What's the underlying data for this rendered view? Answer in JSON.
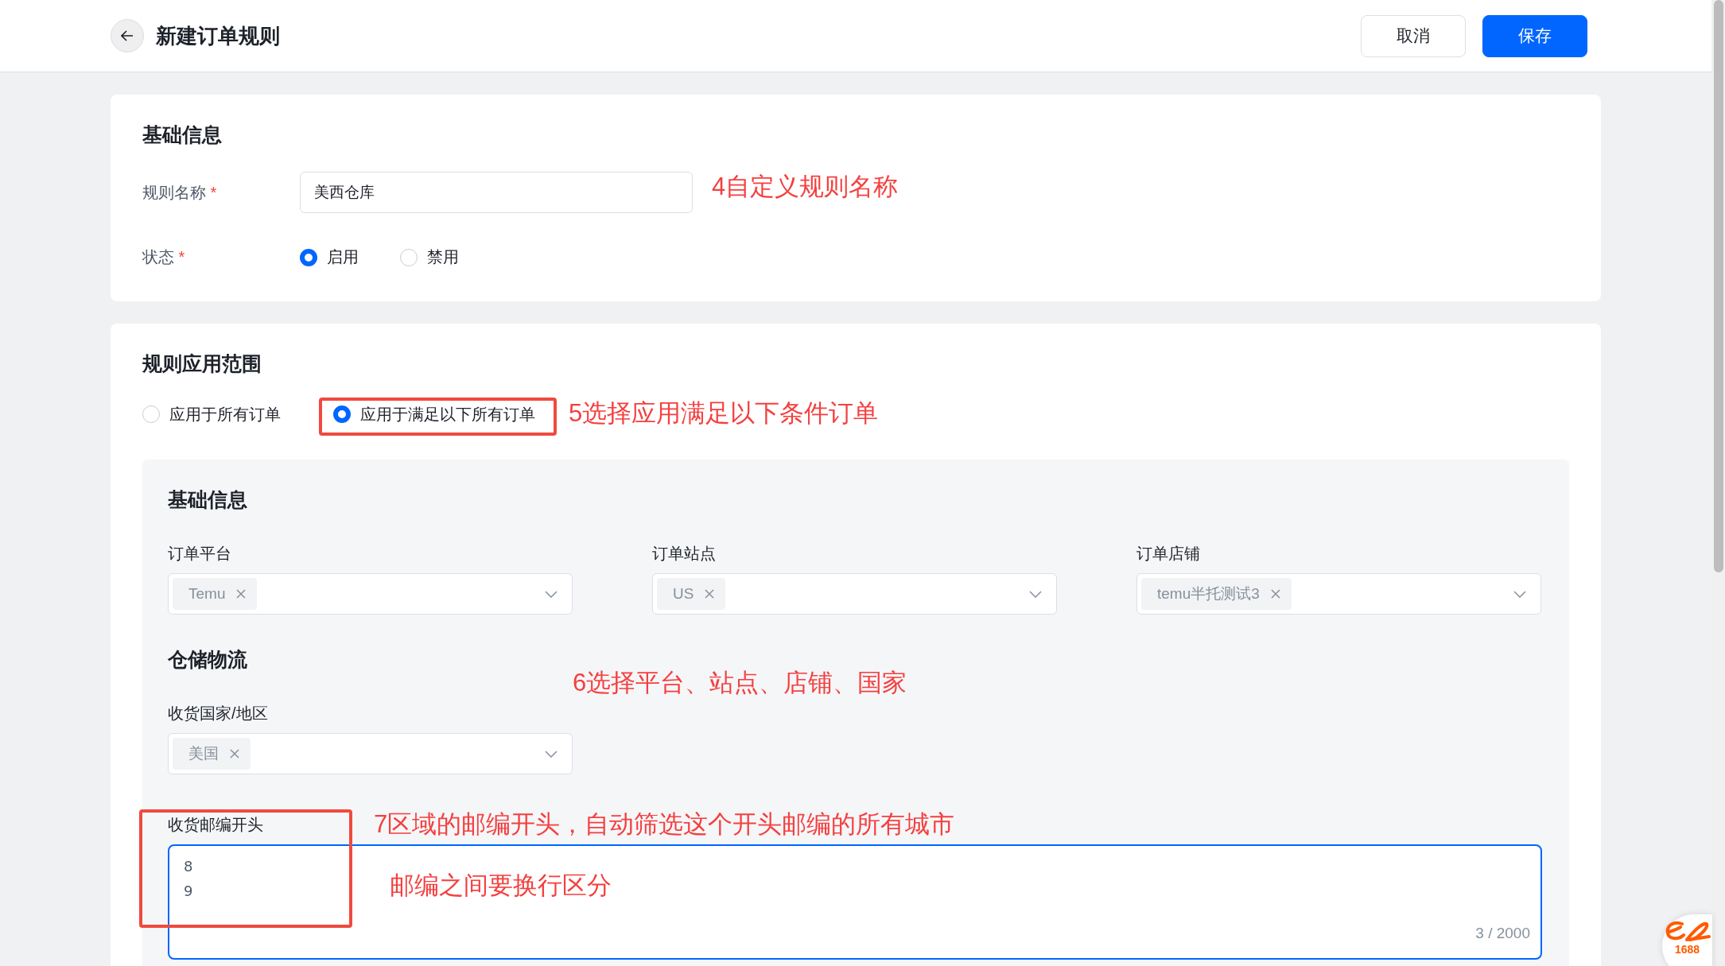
{
  "header": {
    "title": "新建订单规则",
    "buttons": [
      {
        "label": "取消",
        "kind": "default"
      },
      {
        "label": "保存",
        "kind": "primary"
      }
    ]
  },
  "basic": {
    "title": "基础信息",
    "name_field": {
      "label": "规则名称",
      "required_mark": "*",
      "value": "美西仓库"
    },
    "status": {
      "label": "状态",
      "required_mark": "*",
      "options": [
        {
          "label": "启用",
          "selected": true
        },
        {
          "label": "禁用",
          "selected": false
        }
      ]
    }
  },
  "scope": {
    "title": "规则应用范围",
    "options": [
      {
        "label": "应用于所有订单",
        "selected": false
      },
      {
        "label": "应用于满足以下所有订单",
        "selected": true
      }
    ],
    "panel": {
      "sections": [
        {
          "title": "基础信息",
          "fields": [
            {
              "label": "订单平台",
              "tags": [
                "Temu"
              ]
            },
            {
              "label": "订单站点",
              "tags": [
                "US"
              ]
            },
            {
              "label": "订单店铺",
              "tags": [
                "temu半托测试3"
              ]
            }
          ]
        },
        {
          "title": "仓储物流",
          "fields": [
            {
              "label": "收货国家/地区",
              "tags": [
                "美国"
              ]
            }
          ]
        }
      ],
      "zip": {
        "label": "收货邮编开头",
        "value": "8\n9",
        "counter": "3 / 2000"
      }
    }
  },
  "annotations": [
    "4自定义规则名称",
    "5选择应用满足以下条件订单",
    "6选择平台、站点、店铺、国家",
    "7区域的邮编开头，自动筛选这个开头邮编的所有城市",
    "邮编之间要换行区分"
  ],
  "float_logo": {
    "text": "1688"
  }
}
